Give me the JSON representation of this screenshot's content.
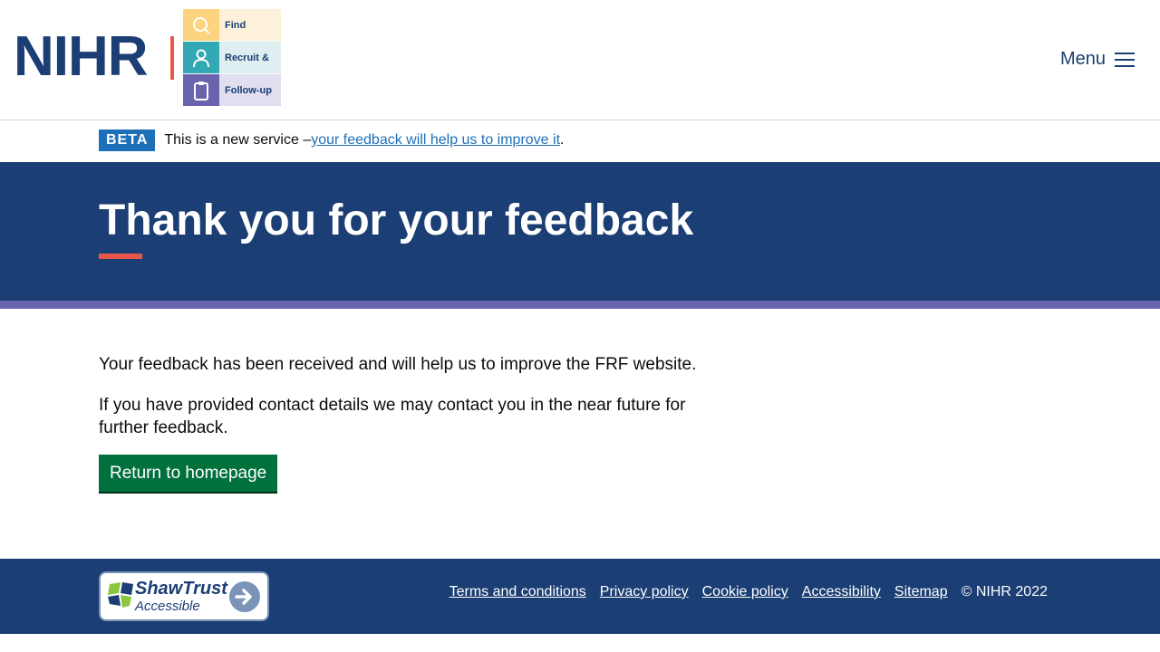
{
  "header": {
    "logo_text": "NIHR",
    "logo_tiles": [
      {
        "label": "Find",
        "icon": "search-icon"
      },
      {
        "label": "Recruit &",
        "icon": "person-icon"
      },
      {
        "label": "Follow-up",
        "icon": "clipboard-icon"
      }
    ],
    "menu_label": "Menu",
    "menu_icon": "hamburger-icon"
  },
  "beta": {
    "tag": "BETA",
    "text": "This is a new service – ",
    "link": "your feedback will help us to improve it",
    "suffix": "."
  },
  "hero": {
    "title": "Thank you for your feedback"
  },
  "main": {
    "paragraphs": [
      "Your feedback has been received and will help us to improve the FRF website.",
      "If you have provided contact details we may contact you in the near future for further feedback."
    ],
    "button_label": "Return to homepage"
  },
  "footer": {
    "badge_title": "ShawTrust",
    "badge_subtitle": "Accessible",
    "links": [
      "Terms and conditions",
      "Privacy policy",
      "Cookie policy",
      "Accessibility",
      "Sitemap"
    ],
    "copyright": "© NIHR 2022"
  },
  "colors": {
    "brand_navy": "#1b3e74",
    "accent_red": "#e8564a",
    "stripe_purple": "#6a64ae",
    "beta_blue": "#1d70b8",
    "button_green": "#00703c"
  }
}
